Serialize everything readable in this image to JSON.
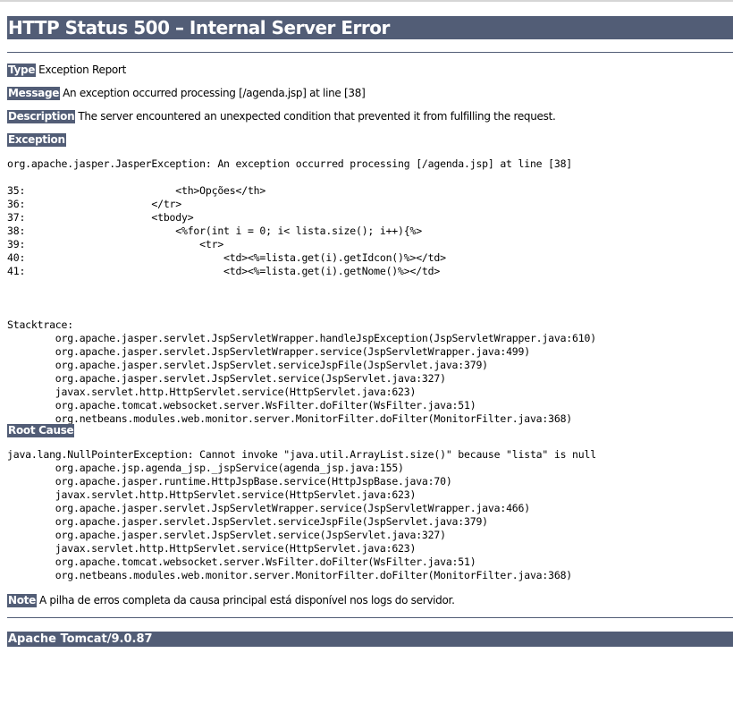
{
  "title": "HTTP Status 500 – Internal Server Error",
  "type": {
    "label": "Type",
    "value": "Exception Report"
  },
  "message": {
    "label": "Message",
    "value": "An exception occurred processing [/agenda.jsp] at line [38]"
  },
  "description": {
    "label": "Description",
    "value": "The server encountered an unexpected condition that prevented it from fulfilling the request."
  },
  "exception": {
    "label": "Exception",
    "header": "org.apache.jasper.JasperException: An exception occurred processing [/agenda.jsp] at line [38]",
    "code_lines": [
      "35:                         <th>Opções</th>",
      "36:                     </tr>",
      "37:                     <tbody>",
      "38:                         <%for(int i = 0; i< lista.size(); i++){%>",
      "39:                             <tr>",
      "40:                                 <td><%=lista.get(i).getIdcon()%></td>",
      "41:                                 <td><%=lista.get(i).getNome()%></td>"
    ],
    "stacktrace_label": "Stacktrace:",
    "stacktrace": [
      "\torg.apache.jasper.servlet.JspServletWrapper.handleJspException(JspServletWrapper.java:610)",
      "\torg.apache.jasper.servlet.JspServletWrapper.service(JspServletWrapper.java:499)",
      "\torg.apache.jasper.servlet.JspServlet.serviceJspFile(JspServlet.java:379)",
      "\torg.apache.jasper.servlet.JspServlet.service(JspServlet.java:327)",
      "\tjavax.servlet.http.HttpServlet.service(HttpServlet.java:623)",
      "\torg.apache.tomcat.websocket.server.WsFilter.doFilter(WsFilter.java:51)",
      "\torg.netbeans.modules.web.monitor.server.MonitorFilter.doFilter(MonitorFilter.java:368)"
    ]
  },
  "root_cause": {
    "label": "Root Cause",
    "header": "java.lang.NullPointerException: Cannot invoke \"java.util.ArrayList.size()\" because \"lista\" is null",
    "stacktrace": [
      "\torg.apache.jsp.agenda_jsp._jspService(agenda_jsp.java:155)",
      "\torg.apache.jasper.runtime.HttpJspBase.service(HttpJspBase.java:70)",
      "\tjavax.servlet.http.HttpServlet.service(HttpServlet.java:623)",
      "\torg.apache.jasper.servlet.JspServletWrapper.service(JspServletWrapper.java:466)",
      "\torg.apache.jasper.servlet.JspServlet.serviceJspFile(JspServlet.java:379)",
      "\torg.apache.jasper.servlet.JspServlet.service(JspServlet.java:327)",
      "\tjavax.servlet.http.HttpServlet.service(HttpServlet.java:623)",
      "\torg.apache.tomcat.websocket.server.WsFilter.doFilter(WsFilter.java:51)",
      "\torg.netbeans.modules.web.monitor.server.MonitorFilter.doFilter(MonitorFilter.java:368)"
    ]
  },
  "note": {
    "label": "Note",
    "value": "A pilha de erros completa da causa principal está disponível nos logs do servidor."
  },
  "footer": "Apache Tomcat/9.0.87",
  "colors": {
    "header_bg": "#525D76",
    "header_text": "#ffffff"
  }
}
